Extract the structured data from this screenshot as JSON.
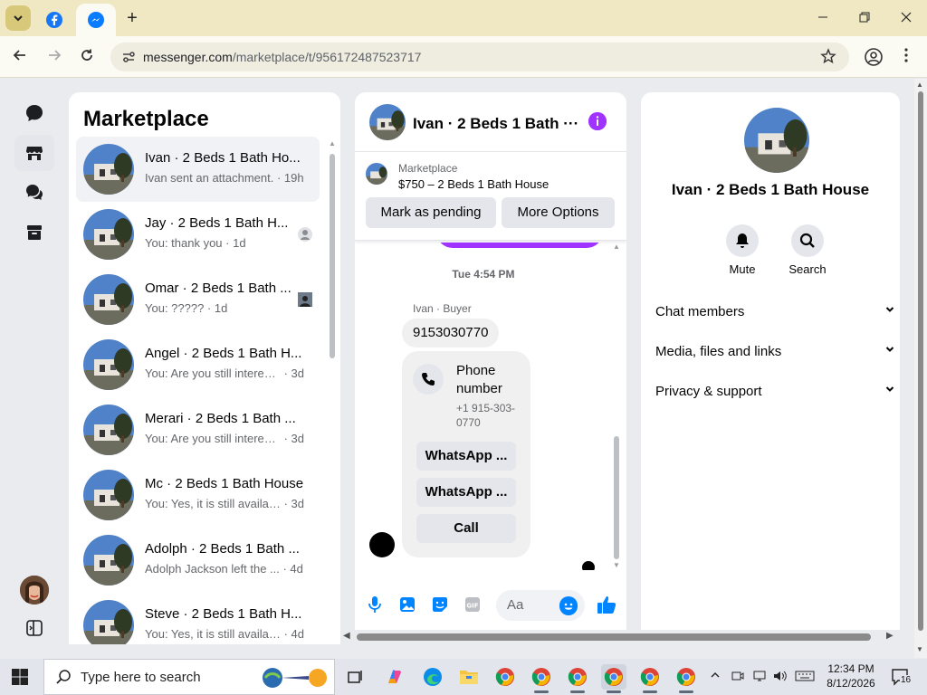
{
  "browser": {
    "url_host": "messenger.com",
    "url_path": "/marketplace/t/956172487523717",
    "new_tab_label": "+"
  },
  "sidebar_title": "Marketplace",
  "conversations": [
    {
      "name": "Ivan · 2 Beds 1 Bath Ho...",
      "snippet": "Ivan sent an attachment.",
      "time": " · 19h"
    },
    {
      "name": "Jay · 2 Beds 1 Bath H...",
      "snippet": "You: thank you",
      "time": " · 1d"
    },
    {
      "name": "Omar · 2 Beds 1 Bath ...",
      "snippet": "You: ?????",
      "time": " · 1d"
    },
    {
      "name": "Angel · 2 Beds 1 Bath H...",
      "snippet": "You: Are you still interest...",
      "time": " · 3d"
    },
    {
      "name": "Merari · 2 Beds 1 Bath ...",
      "snippet": "You: Are you still interest...",
      "time": " · 3d"
    },
    {
      "name": "Mc · 2 Beds 1 Bath House",
      "snippet": "You: Yes, it is still availabl...",
      "time": " · 3d"
    },
    {
      "name": "Adolph · 2 Beds 1 Bath ...",
      "snippet": "Adolph Jackson left the ...",
      "time": " · 4d"
    },
    {
      "name": "Steve · 2 Beds 1 Bath H...",
      "snippet": "You: Yes, it is still availabl...",
      "time": " · 4d"
    }
  ],
  "chat": {
    "title": "Ivan · 2 Beds 1 Bath ···",
    "listing_label": "Marketplace",
    "listing_price": "$750 – 2 Beds 1 Bath House",
    "mark_pending_label": "Mark as pending",
    "more_options_label": "More Options",
    "timestamp": "Tue 4:54 PM",
    "sender": "Ivan · Buyer",
    "message": "9153030770",
    "card_title": "Phone number",
    "card_number": "+1 915-303-0770",
    "whatsapp_1": "WhatsApp ...",
    "whatsapp_2": "WhatsApp ...",
    "call_label": "Call",
    "composer_placeholder": "Aa"
  },
  "info": {
    "title": "Ivan · 2 Beds 1 Bath House",
    "mute_label": "Mute",
    "search_label": "Search",
    "sections": [
      "Chat members",
      "Media, files and links",
      "Privacy & support"
    ]
  },
  "taskbar": {
    "search_placeholder": "Type here to search",
    "time": "12:34 PM",
    "date": "8/12/2026",
    "notifications": "16"
  },
  "colors": {
    "messenger_purple": "#a033ff",
    "messenger_blue": "#0084ff"
  }
}
